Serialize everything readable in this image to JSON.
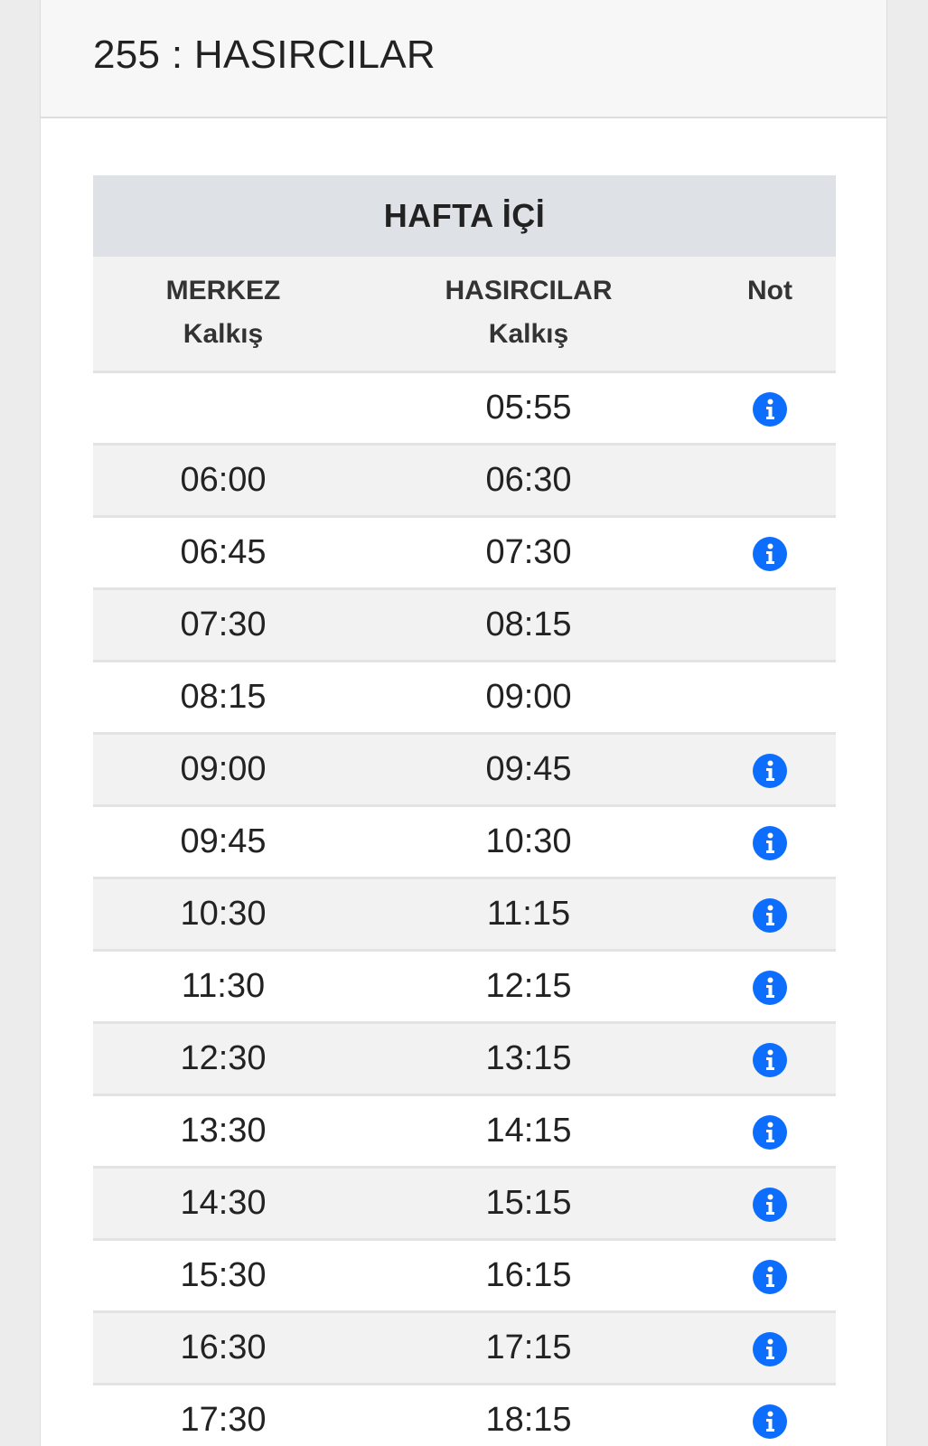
{
  "header": {
    "title": "255 : HASIRCILAR"
  },
  "table": {
    "caption": "HAFTA İÇİ",
    "columns": {
      "merkez": {
        "line1": "MERKEZ",
        "line2": "Kalkış"
      },
      "hasircilar": {
        "line1": "HASIRCILAR",
        "line2": "Kalkış"
      },
      "note": "Not"
    },
    "rows": [
      {
        "merkez": "",
        "hasircilar": "05:55",
        "has_note": true
      },
      {
        "merkez": "06:00",
        "hasircilar": "06:30",
        "has_note": false
      },
      {
        "merkez": "06:45",
        "hasircilar": "07:30",
        "has_note": true
      },
      {
        "merkez": "07:30",
        "hasircilar": "08:15",
        "has_note": false
      },
      {
        "merkez": "08:15",
        "hasircilar": "09:00",
        "has_note": false
      },
      {
        "merkez": "09:00",
        "hasircilar": "09:45",
        "has_note": true
      },
      {
        "merkez": "09:45",
        "hasircilar": "10:30",
        "has_note": true
      },
      {
        "merkez": "10:30",
        "hasircilar": "11:15",
        "has_note": true
      },
      {
        "merkez": "11:30",
        "hasircilar": "12:15",
        "has_note": true
      },
      {
        "merkez": "12:30",
        "hasircilar": "13:15",
        "has_note": true
      },
      {
        "merkez": "13:30",
        "hasircilar": "14:15",
        "has_note": true
      },
      {
        "merkez": "14:30",
        "hasircilar": "15:15",
        "has_note": true
      },
      {
        "merkez": "15:30",
        "hasircilar": "16:15",
        "has_note": true
      },
      {
        "merkez": "16:30",
        "hasircilar": "17:15",
        "has_note": true
      },
      {
        "merkez": "17:30",
        "hasircilar": "18:15",
        "has_note": true
      }
    ]
  },
  "icons": {
    "note_icon": "info-circle-icon"
  },
  "colors": {
    "info_blue": "#0d6efd",
    "caption_bg": "#dee1e5",
    "stripe_bg": "#f2f2f2"
  }
}
